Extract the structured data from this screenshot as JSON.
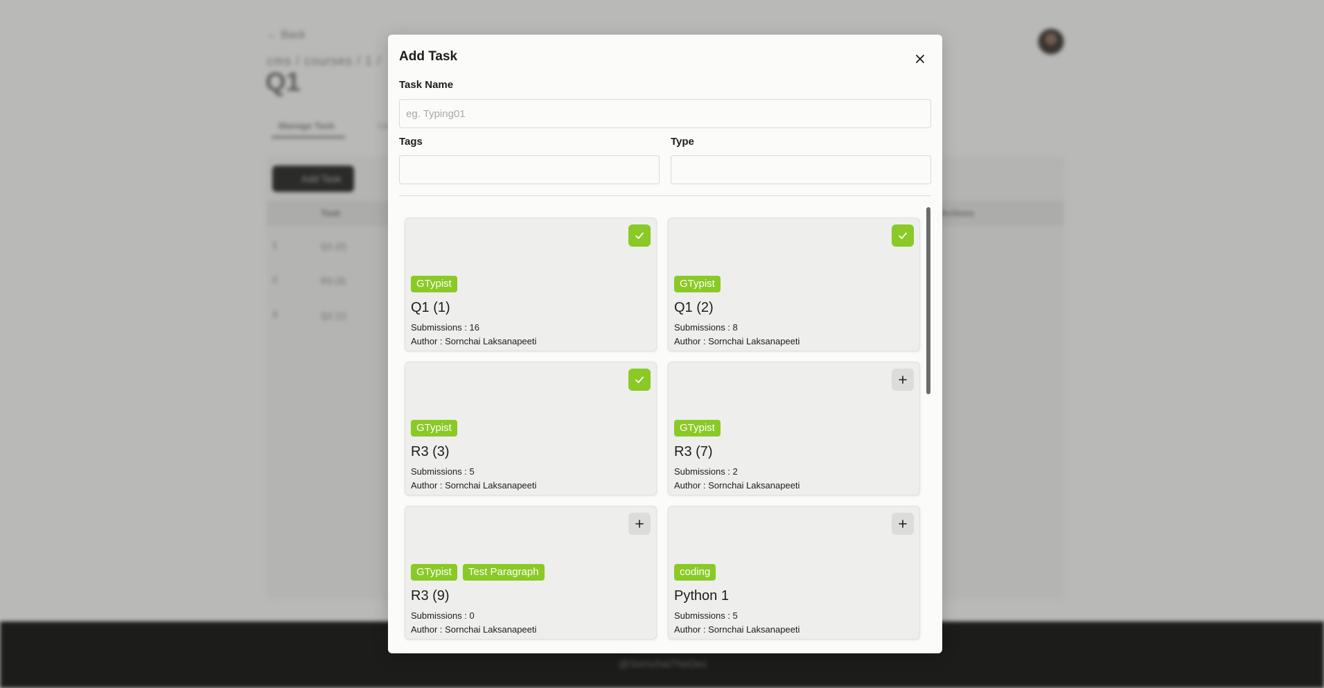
{
  "background": {
    "back_label": "← Back",
    "breadcrumb": "cms / courses / 1 /",
    "title": "Q1",
    "tabs": [
      "Manage Task",
      "Ha"
    ],
    "add_task_label": "Add Task",
    "table_headers": [
      "Task",
      "Actions"
    ],
    "rows": [
      {
        "index": "1",
        "name": "Q1 (2)"
      },
      {
        "index": "2",
        "name": "R3 (3)"
      },
      {
        "index": "3",
        "name": "Q1 (1)"
      }
    ],
    "footer_text": "@SornchaiTheDev"
  },
  "modal": {
    "title": "Add Task",
    "task_name_label": "Task Name",
    "task_name_placeholder": "eg. Typing01",
    "task_name_value": "",
    "tags_label": "Tags",
    "tags_value": "",
    "type_label": "Type",
    "type_value": ""
  },
  "colors": {
    "accent": "#8ac926",
    "modal_bg": "#fbfbf9",
    "card_bg": "#eeeeec"
  },
  "tasks": [
    {
      "title": "Q1 (1)",
      "tags": [
        "GTypist"
      ],
      "submissions": "Submissions : 16",
      "author": "Author : Sornchai Laksanapeeti",
      "selected": true,
      "icon": "check-icon"
    },
    {
      "title": "Q1 (2)",
      "tags": [
        "GTypist"
      ],
      "submissions": "Submissions : 8",
      "author": "Author : Sornchai Laksanapeeti",
      "selected": true,
      "icon": "check-icon"
    },
    {
      "title": "R3 (3)",
      "tags": [
        "GTypist"
      ],
      "submissions": "Submissions : 5",
      "author": "Author : Sornchai Laksanapeeti",
      "selected": true,
      "icon": "check-icon"
    },
    {
      "title": "R3 (7)",
      "tags": [
        "GTypist"
      ],
      "submissions": "Submissions : 2",
      "author": "Author : Sornchai Laksanapeeti",
      "selected": false,
      "icon": "plus-icon"
    },
    {
      "title": "R3 (9)",
      "tags": [
        "GTypist",
        "Test Paragraph"
      ],
      "submissions": "Submissions : 0",
      "author": "Author : Sornchai Laksanapeeti",
      "selected": false,
      "icon": "plus-icon"
    },
    {
      "title": "Python 1",
      "tags": [
        "coding"
      ],
      "submissions": "Submissions : 5",
      "author": "Author : Sornchai Laksanapeeti",
      "selected": false,
      "icon": "plus-icon"
    }
  ]
}
